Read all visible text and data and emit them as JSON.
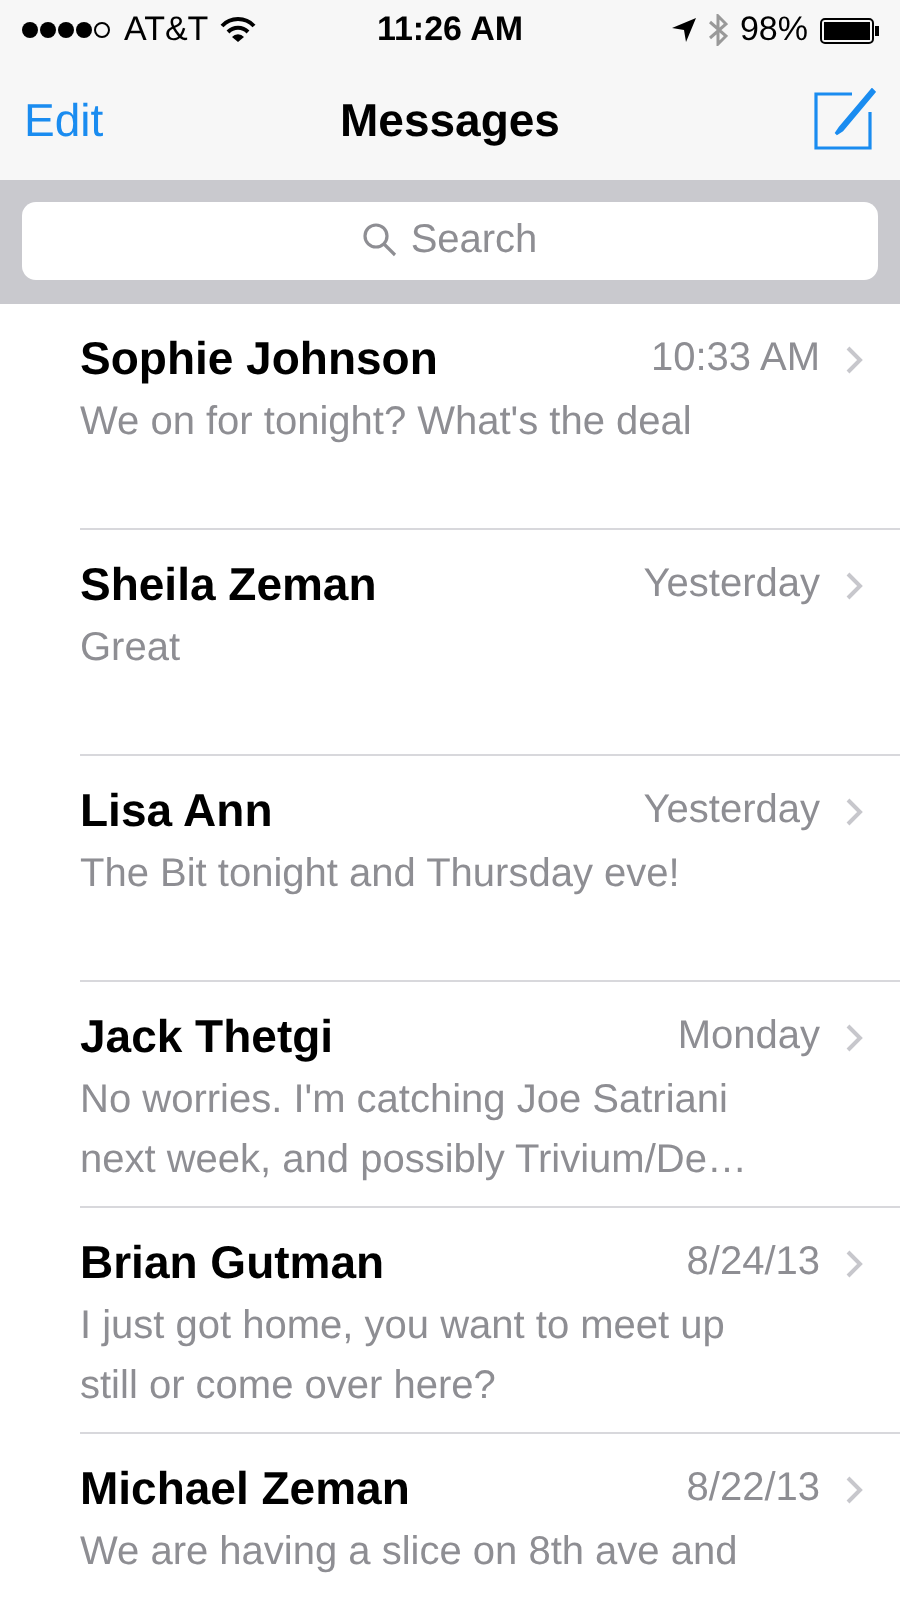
{
  "status_bar": {
    "carrier": "AT&T",
    "time": "11:26 AM",
    "battery": "98%"
  },
  "nav": {
    "left": "Edit",
    "title": "Messages"
  },
  "search": {
    "placeholder": "Search"
  },
  "conversations": [
    {
      "name": "Sophie Johnson",
      "time": "10:33 AM",
      "preview": "We on for tonight? What's the deal"
    },
    {
      "name": "Sheila Zeman",
      "time": "Yesterday",
      "preview": "Great"
    },
    {
      "name": "Lisa Ann",
      "time": "Yesterday",
      "preview": "The Bit tonight and Thursday eve!"
    },
    {
      "name": "Jack Thetgi",
      "time": "Monday",
      "preview": "No worries. I'm catching Joe Satriani next week, and possibly Trivium/De…"
    },
    {
      "name": "Brian Gutman",
      "time": "8/24/13",
      "preview": "I just got home, you want to meet up still or come over here?"
    },
    {
      "name": "Michael Zeman",
      "time": "8/22/13",
      "preview": "We are having a slice on 8th ave and"
    }
  ]
}
